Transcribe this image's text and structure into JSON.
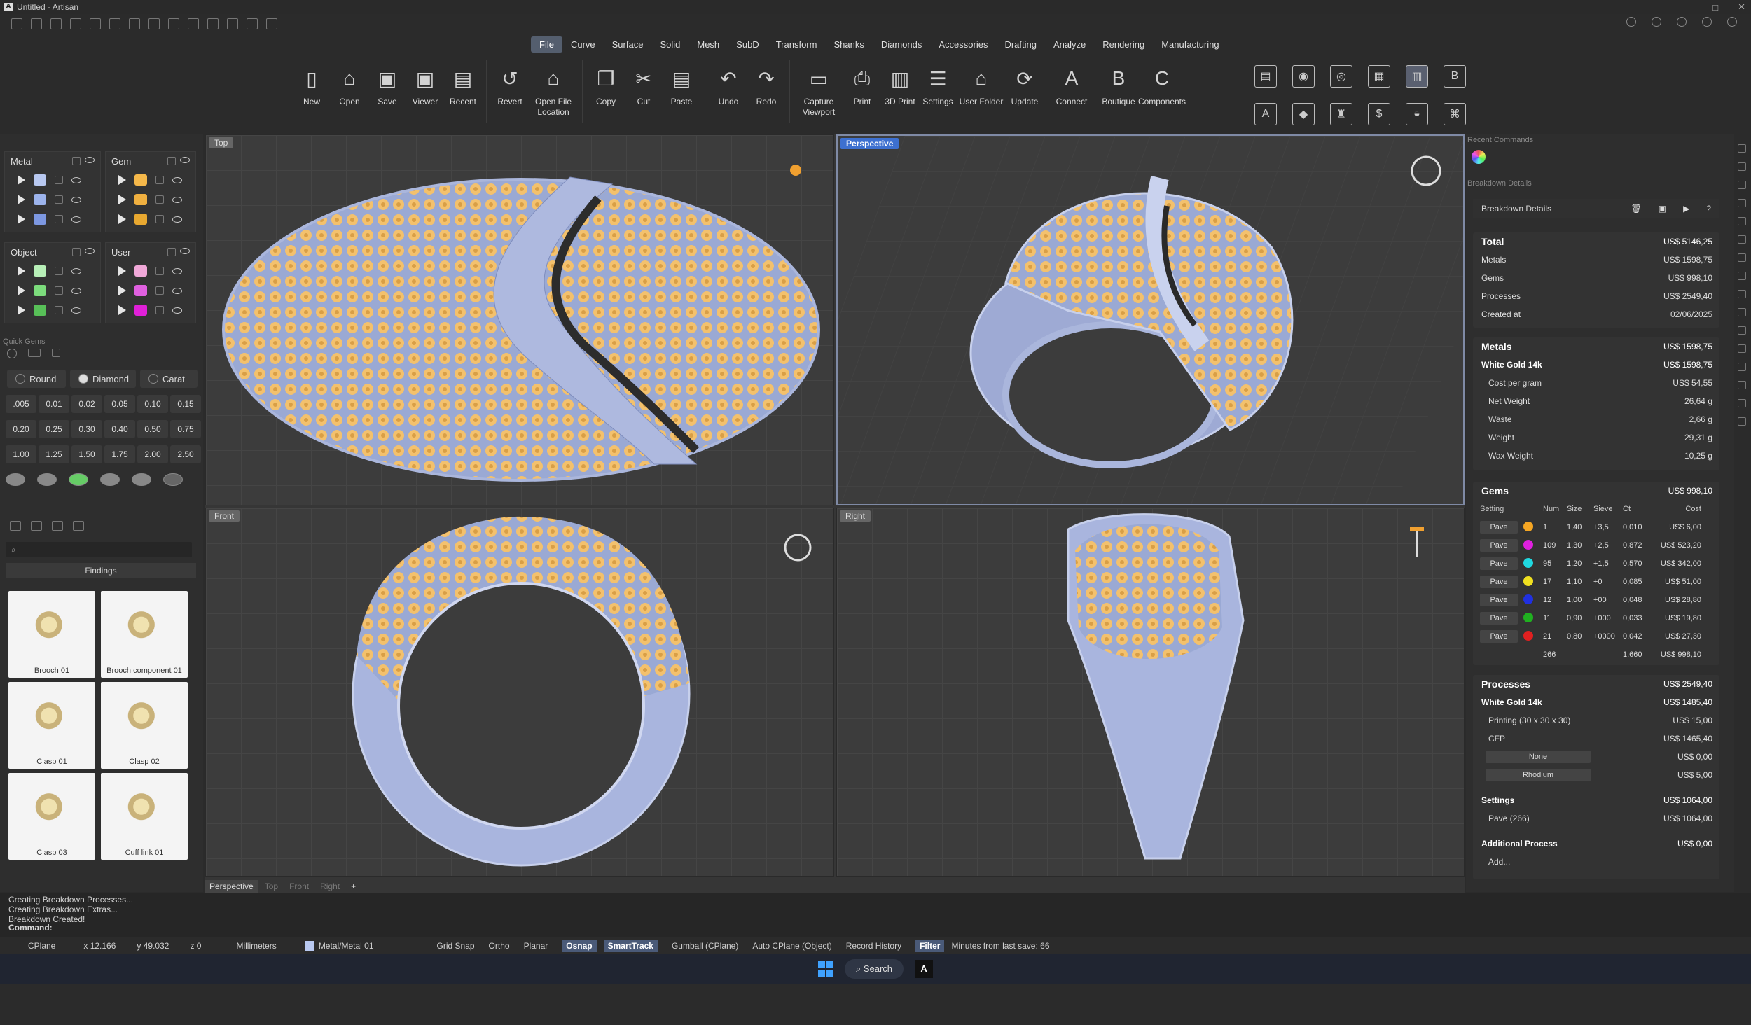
{
  "window": {
    "title": "Untitled - Artisan"
  },
  "menu": [
    "File",
    "Curve",
    "Surface",
    "Solid",
    "Mesh",
    "SubD",
    "Transform",
    "Shanks",
    "Diamonds",
    "Accessories",
    "Drafting",
    "Analyze",
    "Rendering",
    "Manufacturing"
  ],
  "ribbon": [
    {
      "label": "New",
      "icon": "new-file-icon"
    },
    {
      "label": "Open",
      "icon": "open-folder-icon"
    },
    {
      "label": "Save",
      "icon": "save-icon"
    },
    {
      "label": "Viewer",
      "icon": "viewer-icon"
    },
    {
      "label": "Recent",
      "icon": "recent-icon"
    },
    {
      "label": "Revert",
      "icon": "revert-icon"
    },
    {
      "label": "Open File Location",
      "icon": "folder-location-icon"
    },
    {
      "label": "Copy",
      "icon": "copy-icon"
    },
    {
      "label": "Cut",
      "icon": "cut-icon"
    },
    {
      "label": "Paste",
      "icon": "paste-icon"
    },
    {
      "label": "Undo",
      "icon": "undo-icon"
    },
    {
      "label": "Redo",
      "icon": "redo-icon"
    },
    {
      "label": "Capture Viewport",
      "icon": "capture-icon"
    },
    {
      "label": "Print",
      "icon": "print-icon"
    },
    {
      "label": "3D Print",
      "icon": "3d-print-icon"
    },
    {
      "label": "Settings",
      "icon": "settings-icon"
    },
    {
      "label": "User Folder",
      "icon": "user-folder-icon"
    },
    {
      "label": "Update",
      "icon": "update-icon"
    },
    {
      "label": "Connect",
      "icon": "connect-icon"
    },
    {
      "label": "Boutique",
      "icon": "boutique-icon"
    },
    {
      "label": "Components",
      "icon": "components-icon"
    }
  ],
  "layers": {
    "metal": {
      "title": "Metal",
      "colors": [
        "#b8c8f0",
        "#9cb3ec",
        "#7d98e2"
      ]
    },
    "gem": {
      "title": "Gem",
      "colors": [
        "#f5b84a",
        "#f0b040",
        "#e8a830"
      ]
    },
    "object": {
      "title": "Object",
      "colors": [
        "#b8f0b8",
        "#7cdc7c",
        "#58c058"
      ]
    },
    "user": {
      "title": "User",
      "colors": [
        "#f0a8d8",
        "#e060e0",
        "#e020d8"
      ]
    }
  },
  "quick_gems": {
    "title": "Quick Gems",
    "shape": "Round",
    "type": "Diamond",
    "unit": "Carat",
    "sizes": [
      ".005",
      "0.01",
      "0.02",
      "0.05",
      "0.10",
      "0.15",
      "0.20",
      "0.25",
      "0.30",
      "0.40",
      "0.50",
      "0.75",
      "1.00",
      "1.25",
      "1.50",
      "1.75",
      "2.00",
      "2.50"
    ]
  },
  "findings": {
    "title": "Findings",
    "items": [
      "Brooch 01",
      "Brooch component 01",
      "Clasp 01",
      "Clasp 02",
      "Clasp 03",
      "Cuff link 01"
    ]
  },
  "viewports": {
    "top": "Top",
    "perspective": "Perspective",
    "front": "Front",
    "right": "Right",
    "tabs": [
      "Perspective",
      "Top",
      "Front",
      "Right"
    ]
  },
  "right": {
    "recent_commands": "Recent Commands",
    "breakdown_header": "Breakdown Details",
    "panel_title": "Breakdown Details",
    "total": {
      "label": "Total",
      "value": "US$ 5146,25"
    },
    "summary": [
      [
        "Metals",
        "US$ 1598,75"
      ],
      [
        "Gems",
        "US$ 998,10"
      ],
      [
        "Processes",
        "US$ 2549,40"
      ],
      [
        "Created at",
        "02/06/2025"
      ]
    ],
    "metals": {
      "label": "Metals",
      "value": "US$ 1598,75",
      "alloy": "White Gold 14k",
      "alloy_value": "US$ 1598,75",
      "rows": [
        [
          "Cost per gram",
          "US$ 54,55"
        ],
        [
          "Net Weight",
          "26,64 g"
        ],
        [
          "Waste",
          "2,66 g"
        ],
        [
          "Weight",
          "29,31 g"
        ],
        [
          "Wax Weight",
          "10,25 g"
        ]
      ]
    },
    "gems": {
      "label": "Gems",
      "value": "US$ 998,10",
      "headers": [
        "Setting",
        "Num",
        "Size",
        "Sieve",
        "Ct",
        "Cost"
      ],
      "rows": [
        {
          "setting": "Pave",
          "color": "#f5a623",
          "num": "1",
          "size": "1,40",
          "sieve": "+3,5",
          "ct": "0,010",
          "cost": "US$ 6,00"
        },
        {
          "setting": "Pave",
          "color": "#e020e0",
          "num": "109",
          "size": "1,30",
          "sieve": "+2,5",
          "ct": "0,872",
          "cost": "US$ 523,20"
        },
        {
          "setting": "Pave",
          "color": "#20d8e0",
          "num": "95",
          "size": "1,20",
          "sieve": "+1,5",
          "ct": "0,570",
          "cost": "US$ 342,00"
        },
        {
          "setting": "Pave",
          "color": "#f0e020",
          "num": "17",
          "size": "1,10",
          "sieve": "+0",
          "ct": "0,085",
          "cost": "US$ 51,00"
        },
        {
          "setting": "Pave",
          "color": "#2030e0",
          "num": "12",
          "size": "1,00",
          "sieve": "+00",
          "ct": "0,048",
          "cost": "US$ 28,80"
        },
        {
          "setting": "Pave",
          "color": "#20b020",
          "num": "11",
          "size": "0,90",
          "sieve": "+000",
          "ct": "0,033",
          "cost": "US$ 19,80"
        },
        {
          "setting": "Pave",
          "color": "#e02020",
          "num": "21",
          "size": "0,80",
          "sieve": "+0000",
          "ct": "0,042",
          "cost": "US$ 27,30"
        }
      ],
      "total_num": "266",
      "total_ct": "1,660",
      "total_cost": "US$ 998,10"
    },
    "processes": {
      "label": "Processes",
      "value": "US$ 2549,40",
      "alloy": "White Gold 14k",
      "alloy_value": "US$ 1485,40",
      "printing": [
        "Printing (30 x 30 x 30)",
        "US$ 15,00"
      ],
      "cfp": [
        "CFP",
        "US$ 1465,40"
      ],
      "dd1": [
        "None",
        "US$ 0,00"
      ],
      "dd2": [
        "Rhodium",
        "US$ 5,00"
      ],
      "settings": [
        "Settings",
        "US$ 1064,00"
      ],
      "pave": [
        "Pave (266)",
        "US$ 1064,00"
      ],
      "additional": [
        "Additional Process",
        "US$ 0,00"
      ],
      "add": "Add..."
    }
  },
  "command": {
    "history": [
      "Creating Breakdown Processes...",
      "Creating Breakdown Extras...",
      "Breakdown Created!"
    ],
    "prompt": "Command:"
  },
  "status": {
    "cplane": "CPlane",
    "x": "x 12.166",
    "y": "y 49.032",
    "z": "z 0",
    "units": "Millimeters",
    "layer": "Metal/Metal 01",
    "grid_snap": "Grid Snap",
    "ortho": "Ortho",
    "planar": "Planar",
    "osnap": "Osnap",
    "smarttrack": "SmartTrack",
    "gumball": "Gumball (CPlane)",
    "auto_cplane": "Auto CPlane (Object)",
    "record_history": "Record History",
    "filter": "Filter",
    "save": "Minutes from last save: 66"
  },
  "taskbar": {
    "search": "Search"
  }
}
